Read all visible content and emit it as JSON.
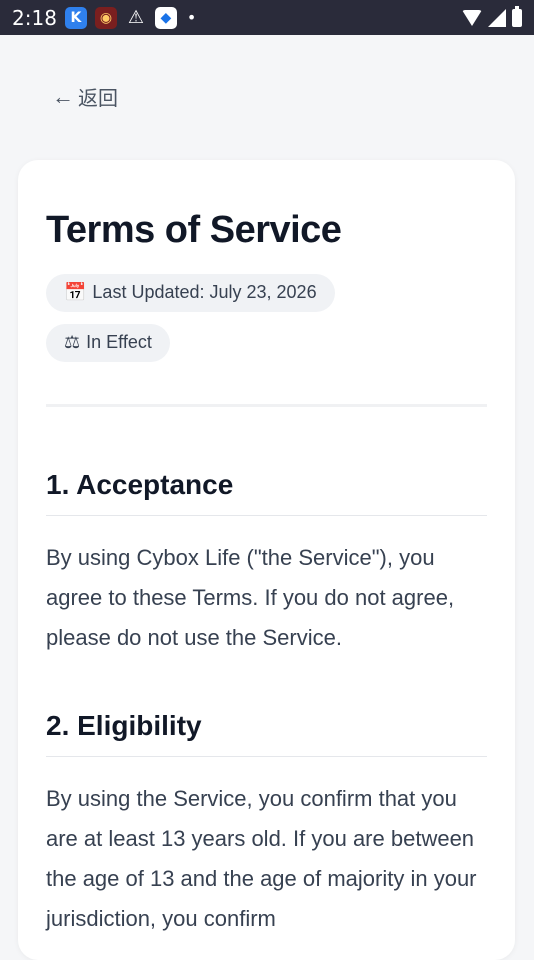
{
  "status_bar": {
    "time": "2:18",
    "app_icons": [
      "k-app-icon",
      "red-app-icon",
      "warning-icon",
      "blue-app-icon"
    ],
    "dot": "•"
  },
  "nav": {
    "back_arrow": "←",
    "back_label": "返回"
  },
  "page": {
    "title": "Terms of Service",
    "updated_icon": "📅",
    "updated_label": "Last Updated: July 23, 2026",
    "status_icon": "⚖",
    "status_label": "In Effect"
  },
  "sections": [
    {
      "heading": "1. Acceptance",
      "body": "By using Cybox Life (\"the Service\"), you agree to these Terms. If you do not agree, please do not use the Service."
    },
    {
      "heading": "2. Eligibility",
      "body": "By using the Service, you confirm that you are at least 13 years old. If you are between the age of 13 and the age of majority in your jurisdiction, you confirm"
    }
  ],
  "colors": {
    "status_bar_bg": "#2a2b3a",
    "page_bg": "#f5f6f8",
    "card_bg": "#ffffff",
    "pill_bg": "#f0f2f5",
    "title_text": "#111827"
  }
}
